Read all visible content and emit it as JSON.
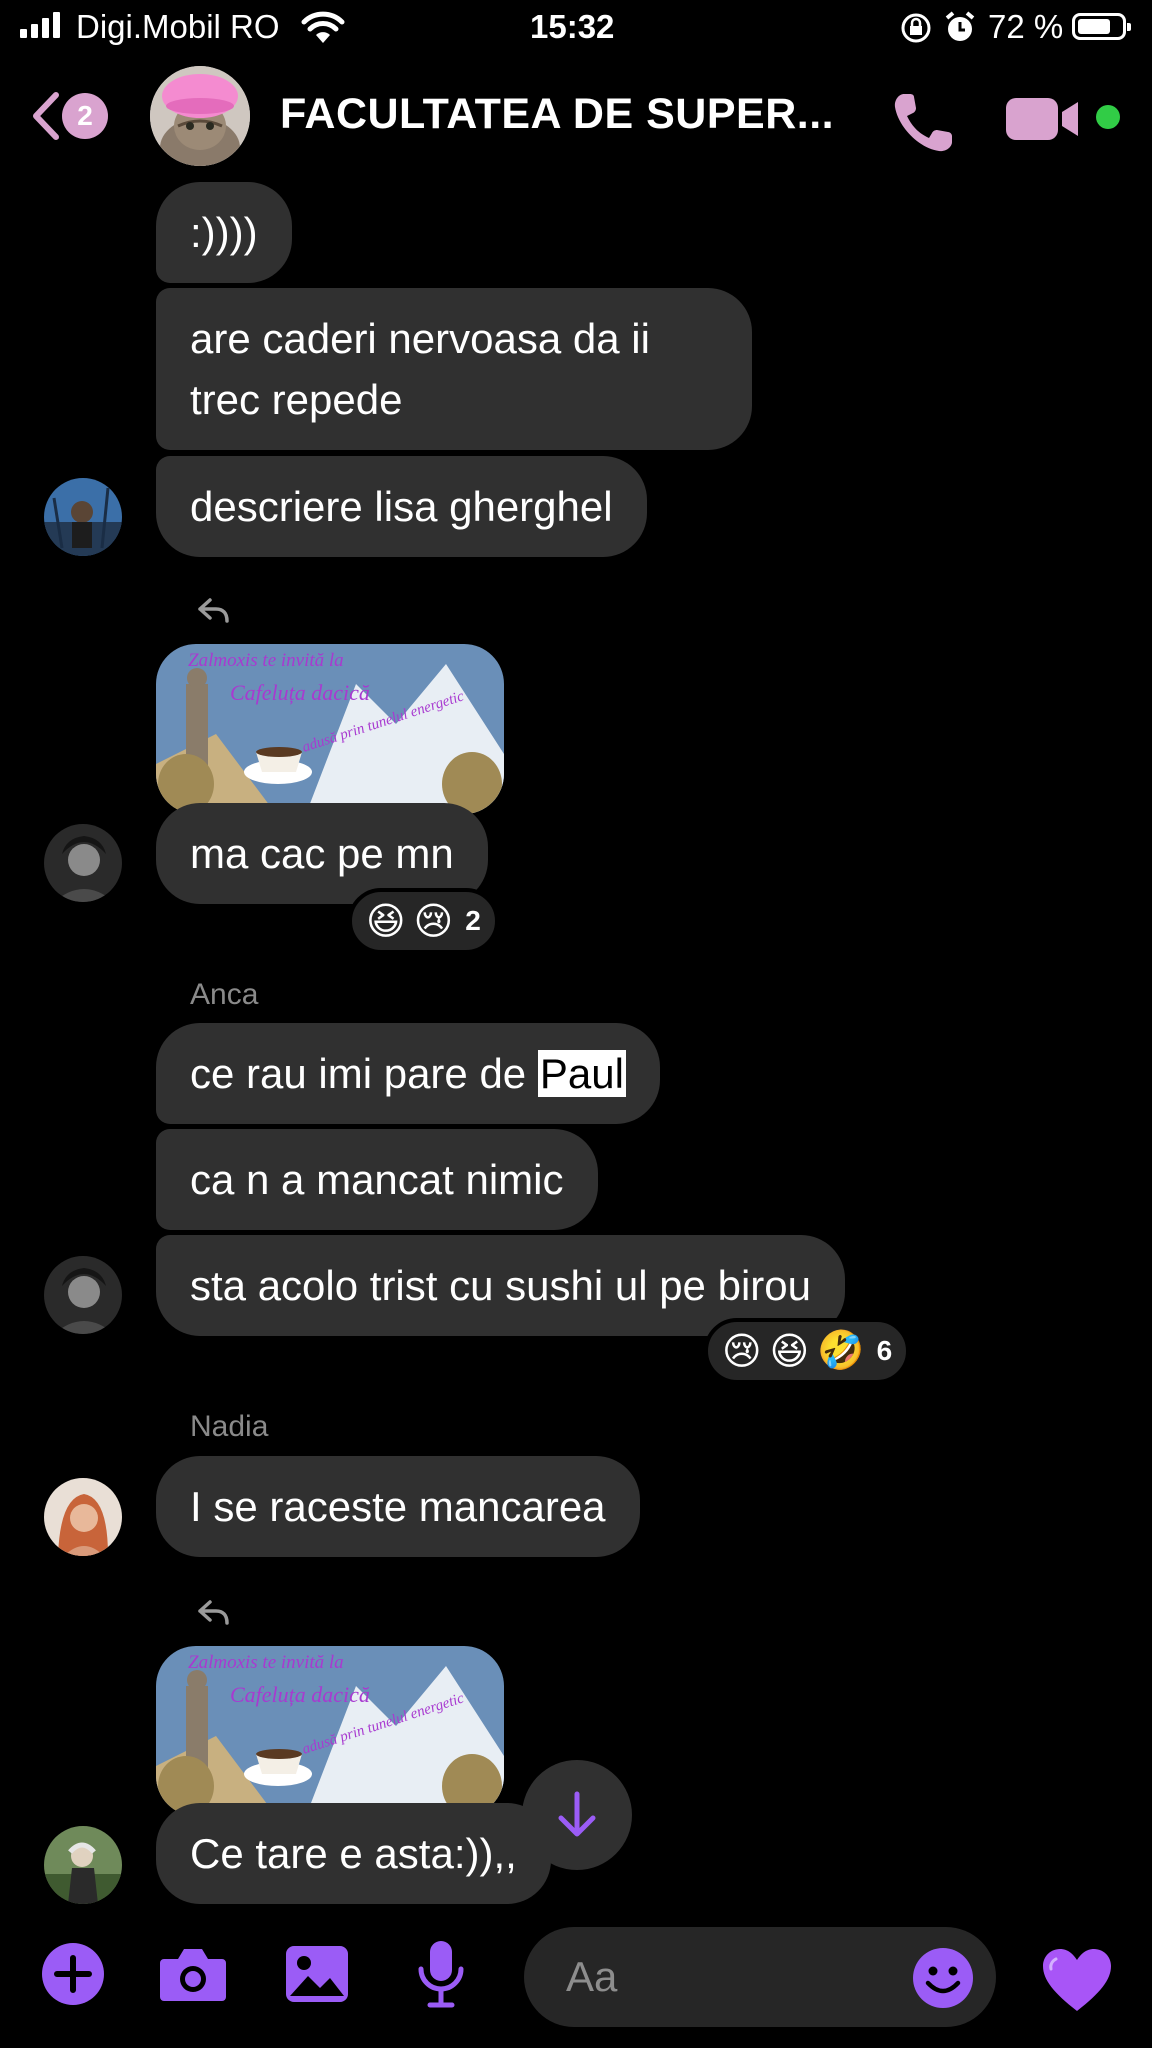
{
  "status_bar": {
    "carrier": "Digi.Mobil RO",
    "time": "15:32",
    "battery": "72 %",
    "battery_level": 0.72
  },
  "header": {
    "back_badge": "2",
    "title": "FACULTATEA DE SUPER...",
    "accent_color": "#d9a3cf",
    "online_color": "#31cc46"
  },
  "messages": {
    "m1": ":))))",
    "m2_line1": "are caderi nervoasa da ii",
    "m2_line2": "trec repede",
    "m3": "descriere lisa gherghel",
    "img_caption_1": "Zalmoxis te invită la",
    "img_caption_2": "Cafeluța dacică",
    "img_caption_3": "adusă prin tunelul energetic",
    "m4": "ma cac pe mn",
    "m4_reactions": [
      "😆",
      "😢"
    ],
    "m4_reaction_count": "2",
    "sender_anca": "Anca",
    "m5_prefix": "ce rau imi pare de ",
    "m5_highlight": "Paul",
    "m6": "ca n a mancat nimic",
    "m7": "sta acolo trist cu sushi ul pe birou",
    "m7_reactions": [
      "😢",
      "😆",
      "🤣"
    ],
    "m7_reaction_count": "6",
    "sender_nadia": "Nadia",
    "m8": "I se raceste mancarea",
    "m9": "Ce tare e asta:)),,"
  },
  "composer": {
    "placeholder": "Aa",
    "accent_color": "#9b5cf6"
  }
}
